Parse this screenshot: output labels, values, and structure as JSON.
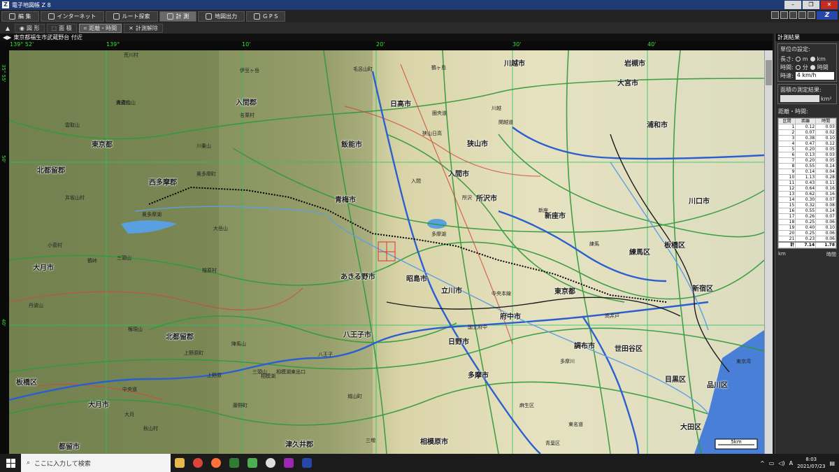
{
  "window": {
    "title": "電子地図帳 Z 8"
  },
  "menu_tabs": [
    {
      "label": "編 集",
      "icon": "edit-icon"
    },
    {
      "label": "インターネット",
      "icon": "globe-icon"
    },
    {
      "label": "ルート探索",
      "icon": "route-icon"
    },
    {
      "label": "計 測",
      "icon": "measure-icon"
    },
    {
      "label": "地図出力",
      "icon": "print-icon"
    },
    {
      "label": "G P S",
      "icon": "gps-icon"
    }
  ],
  "toolbar": {
    "figure": "図 形",
    "area": "面 積",
    "distance": "距離・時間",
    "clear": "計測解除"
  },
  "address": "東京都福生市武蔵野台 付近",
  "coords_top": [
    "139° 52'",
    "139°",
    "10'",
    "20'",
    "30'",
    "40'"
  ],
  "coords_left": [
    "35° 55'",
    "50'",
    "40'"
  ],
  "map_labels": {
    "cities": [
      "川越市",
      "岩槻市",
      "大宮市",
      "日高市",
      "狭山市",
      "入間市",
      "所沢市",
      "浦和市",
      "飯能市",
      "青梅市",
      "入間郡",
      "東京都",
      "西多摩郡",
      "北都留郡",
      "あきる野市",
      "昭島市",
      "立川市",
      "東京都",
      "府中市",
      "調布市",
      "世田谷区",
      "新座市",
      "練馬区",
      "板橋区",
      "新宿区",
      "川口市",
      "大月市",
      "大月市",
      "日野市",
      "八王子市",
      "多摩市",
      "目黒区",
      "品川区",
      "大田区",
      "相模原市",
      "津久井郡",
      "都留市",
      "北都留郡",
      "板橋区"
    ],
    "places": [
      "荒川村",
      "伊豆ヶ岳",
      "毛呂山町",
      "名栗村",
      "大持山",
      "蕎麦粒山",
      "雲取山",
      "川乗山",
      "奥多摩町",
      "井坂山村",
      "大岳山",
      "小菅村",
      "三頭山",
      "鶴峠",
      "檜原村",
      "丹波山",
      "権現山",
      "陣馬山",
      "上野原町",
      "三頭山",
      "秋山村",
      "藤野町",
      "城山町",
      "三増",
      "麻生区",
      "青葉区",
      "東名道",
      "中央道",
      "多摩川",
      "中央本線",
      "関越道",
      "圏央道",
      "狭山日高",
      "入間",
      "所沢",
      "新座",
      "練馬",
      "高井戸",
      "八王子",
      "国立府中",
      "相模湖東出口",
      "相模湖",
      "上野原",
      "大月",
      "川越",
      "鶴ヶ島",
      "多摩湖",
      "奥多摩湖",
      "東京湾"
    ]
  },
  "scale_bar": "5km",
  "panel": {
    "title": "計測結果",
    "unit_title": "単位の設定:",
    "length_label": "長さ:",
    "length_opts": [
      "m",
      "km"
    ],
    "time_label": "時間:",
    "time_opts": [
      "分",
      "時間"
    ],
    "speed_label": "時速:",
    "speed_value": "4 km/h",
    "area_title": "面積の測定結果:",
    "area_unit": "km²",
    "dist_title": "距離・時間:",
    "headers": [
      "区間",
      "距離",
      "時間"
    ],
    "rows": [
      [
        "1",
        "0.12",
        "0.03"
      ],
      [
        "2",
        "0.07",
        "0.02"
      ],
      [
        "3",
        "0.38",
        "0.10"
      ],
      [
        "4",
        "0.47",
        "0.12"
      ],
      [
        "5",
        "0.20",
        "0.05"
      ],
      [
        "6",
        "0.13",
        "0.03"
      ],
      [
        "7",
        "0.20",
        "0.05"
      ],
      [
        "8",
        "0.55",
        "0.14"
      ],
      [
        "9",
        "0.14",
        "0.04"
      ],
      [
        "10",
        "1.13",
        "0.28"
      ],
      [
        "11",
        "0.43",
        "0.11"
      ],
      [
        "12",
        "0.64",
        "0.16"
      ],
      [
        "13",
        "0.62",
        "0.16"
      ],
      [
        "14",
        "0.30",
        "0.07"
      ],
      [
        "15",
        "0.32",
        "0.08"
      ],
      [
        "16",
        "0.55",
        "0.14"
      ],
      [
        "17",
        "0.26",
        "0.07"
      ],
      [
        "18",
        "0.25",
        "0.06"
      ],
      [
        "19",
        "0.40",
        "0.10"
      ],
      [
        "20",
        "0.25",
        "0.06"
      ],
      [
        "21",
        "0.23",
        "0.06"
      ]
    ],
    "total": [
      "計",
      "7.14",
      "1.78"
    ],
    "unit_footer": [
      "km",
      "時間"
    ]
  },
  "taskbar": {
    "search_placeholder": "ここに入力して検索",
    "apps": [
      "file-explorer-icon",
      "chrome-icon",
      "firefox-icon",
      "app-icon",
      "app-icon",
      "media-icon",
      "app-icon",
      "z-map-icon"
    ],
    "ime": "A",
    "time": "8:03",
    "date": "2021/07/23"
  },
  "colors": {
    "titlebar": "#1f3b73",
    "road": "#2f9a3a",
    "river": "#5aa0e0",
    "route": "#000000",
    "grid": "#22c55e"
  }
}
